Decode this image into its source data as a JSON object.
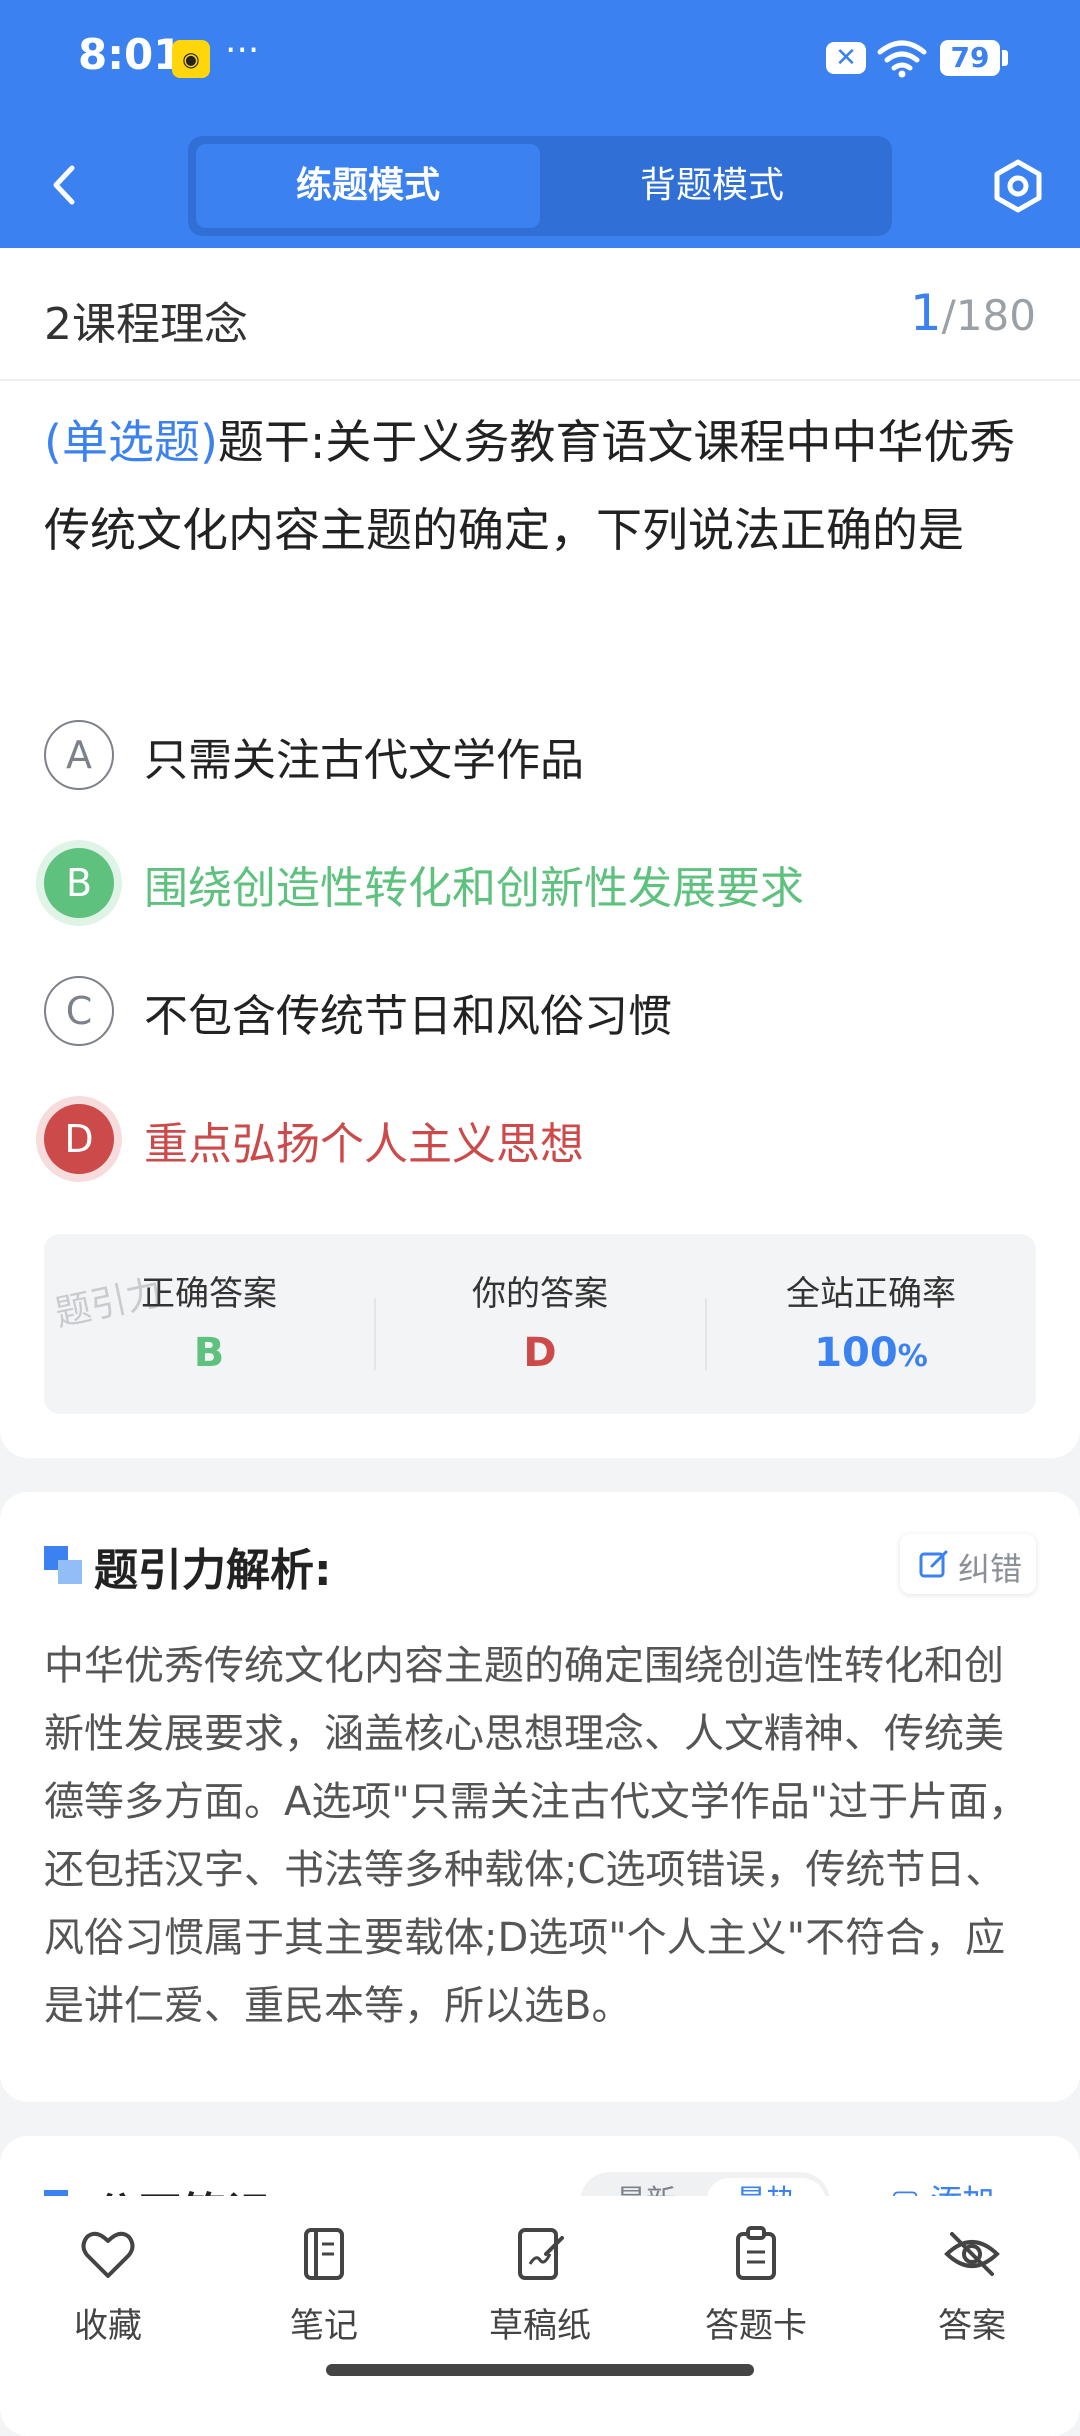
{
  "status_bar": {
    "time": "8:01",
    "app_icon": "app-icon",
    "more": "···",
    "battery": "79"
  },
  "header": {
    "back_icon": "chevron-left-icon",
    "tabs": [
      {
        "label": "练题模式",
        "active": true
      },
      {
        "label": "背题模式",
        "active": false
      }
    ],
    "settings_icon": "gear-icon",
    "accent": "#3b82f0"
  },
  "question": {
    "chapter": "2课程理念",
    "current": "1",
    "total": "/180",
    "type": "(单选题)",
    "stem": "题干:关于义务教育语文课程中中华优秀传统文化内容主题的确定，下列说法正确的是",
    "options": [
      {
        "key": "A",
        "text": "只需关注古代文学作品",
        "state": "normal"
      },
      {
        "key": "B",
        "text": "围绕创造性转化和创新性发展要求",
        "state": "correct"
      },
      {
        "key": "C",
        "text": "不包含传统节日和风俗习惯",
        "state": "normal"
      },
      {
        "key": "D",
        "text": "重点弘扬个人主义思想",
        "state": "wrong"
      }
    ]
  },
  "stats": {
    "watermark": "题引力",
    "correct_label": "正确答案",
    "correct_value": "B",
    "yours_label": "你的答案",
    "yours_value": "D",
    "rate_label": "全站正确率",
    "rate_value": "100",
    "rate_unit": "%",
    "colors": {
      "correct": "#5ec27e",
      "wrong": "#cd4a4a",
      "rate": "#3b82f0"
    }
  },
  "analysis": {
    "title": "题引力解析:",
    "report_label": "纠错",
    "body": "中华优秀传统文化内容主题的确定围绕创造性转化和创新性发展要求，涵盖核心思想理念、人文精神、传统美德等多方面。A选项\"只需关注古代文学作品\"过于片面，还包括汉字、书法等多种载体;C选项错误，传统节日、风俗习惯属于其主要载体;D选项\"个人主义\"不符合，应是讲仁爱、重民本等，所以选B。"
  },
  "notes": {
    "title": "公开笔记:",
    "sort": [
      "最新",
      "最热"
    ],
    "add_label": "添加"
  },
  "bottom_nav": [
    {
      "label": "收藏",
      "icon": "heart-icon"
    },
    {
      "label": "笔记",
      "icon": "notebook-icon"
    },
    {
      "label": "草稿纸",
      "icon": "draft-icon"
    },
    {
      "label": "答题卡",
      "icon": "clipboard-icon"
    },
    {
      "label": "答案",
      "icon": "eye-off-icon"
    }
  ]
}
